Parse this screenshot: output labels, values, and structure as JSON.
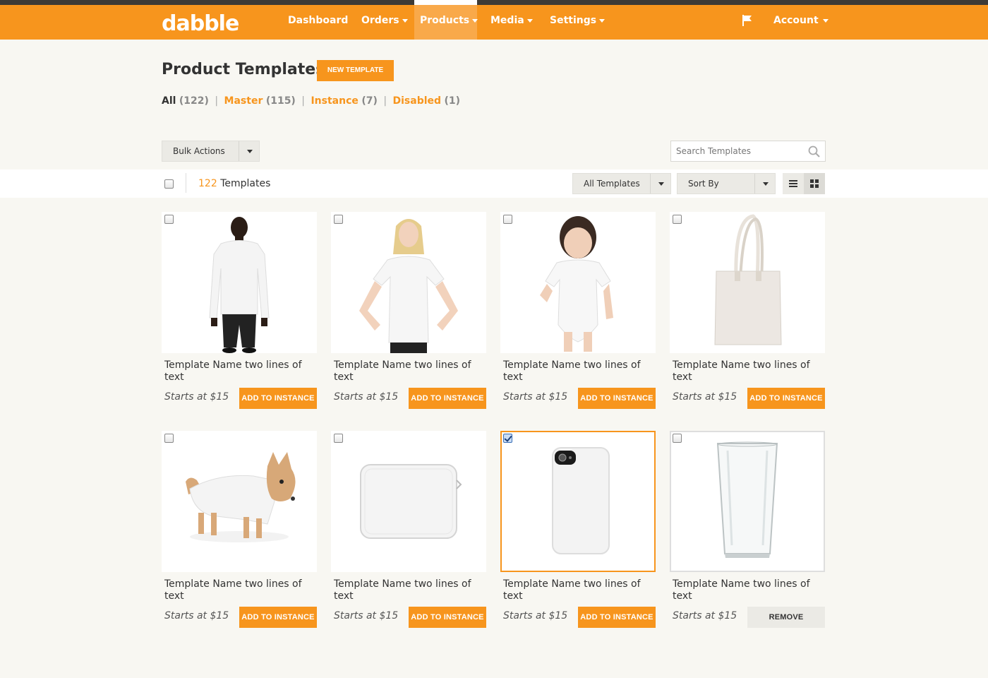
{
  "app": {
    "logo": "dabble"
  },
  "nav": {
    "items": [
      {
        "label": "Dashboard",
        "dropdown": false
      },
      {
        "label": "Orders",
        "dropdown": true
      },
      {
        "label": "Products",
        "dropdown": true,
        "active": true
      },
      {
        "label": "Media",
        "dropdown": true
      },
      {
        "label": "Settings",
        "dropdown": true
      }
    ],
    "flag_icon": "flag-icon",
    "account": "Account"
  },
  "page": {
    "title": "Product Templates",
    "new_button": "NEW TEMPLATE"
  },
  "filters": {
    "all": {
      "label": "All",
      "count": "(122)"
    },
    "master": {
      "label": "Master",
      "count": "(115)"
    },
    "instance": {
      "label": "Instance",
      "count": "(7)"
    },
    "disabled": {
      "label": "Disabled",
      "count": "(1)"
    },
    "separator": "|"
  },
  "toolbar": {
    "bulk_actions": "Bulk Actions",
    "search_placeholder": "Search Templates",
    "count_num": "122",
    "count_label": "Templates",
    "filter_select": "All Templates",
    "sort_select": "Sort By",
    "view_modes": [
      "list-view-icon",
      "grid-view-icon"
    ],
    "active_view": "grid"
  },
  "colors": {
    "brand": "#f7951d",
    "nav_dark": "#3d3a36",
    "background": "#f8f7f2"
  },
  "templates": [
    {
      "image": "man-long-sleeve-shirt",
      "name": "Template Name two lines of text",
      "price": "Starts at $15",
      "action": "ADD TO INSTANCE",
      "checked": false
    },
    {
      "image": "girl-tshirt",
      "name": "Template Name two lines of text",
      "price": "Starts at $15",
      "action": "ADD TO INSTANCE",
      "checked": false
    },
    {
      "image": "baby-onesie",
      "name": "Template Name two lines of text",
      "price": "Starts at $15",
      "action": "ADD TO INSTANCE",
      "checked": false
    },
    {
      "image": "tote-bag",
      "name": "Template Name two lines of text",
      "price": "Starts at $15",
      "action": "ADD TO INSTANCE",
      "checked": false
    },
    {
      "image": "dog-hoodie",
      "name": "Template Name two lines of text",
      "price": "Starts at $15",
      "action": "ADD TO INSTANCE",
      "checked": false
    },
    {
      "image": "laptop-sleeve",
      "name": "Template Name two lines of text",
      "price": "Starts at $15",
      "action": "ADD TO INSTANCE",
      "checked": false
    },
    {
      "image": "phone-case",
      "name": "Template Name two lines of text",
      "price": "Starts at $15",
      "action": "ADD TO INSTANCE",
      "checked": true
    },
    {
      "image": "pint-glass",
      "name": "Template Name two lines of text",
      "price": "Starts at $15",
      "action": "REMOVE",
      "checked": false
    }
  ]
}
